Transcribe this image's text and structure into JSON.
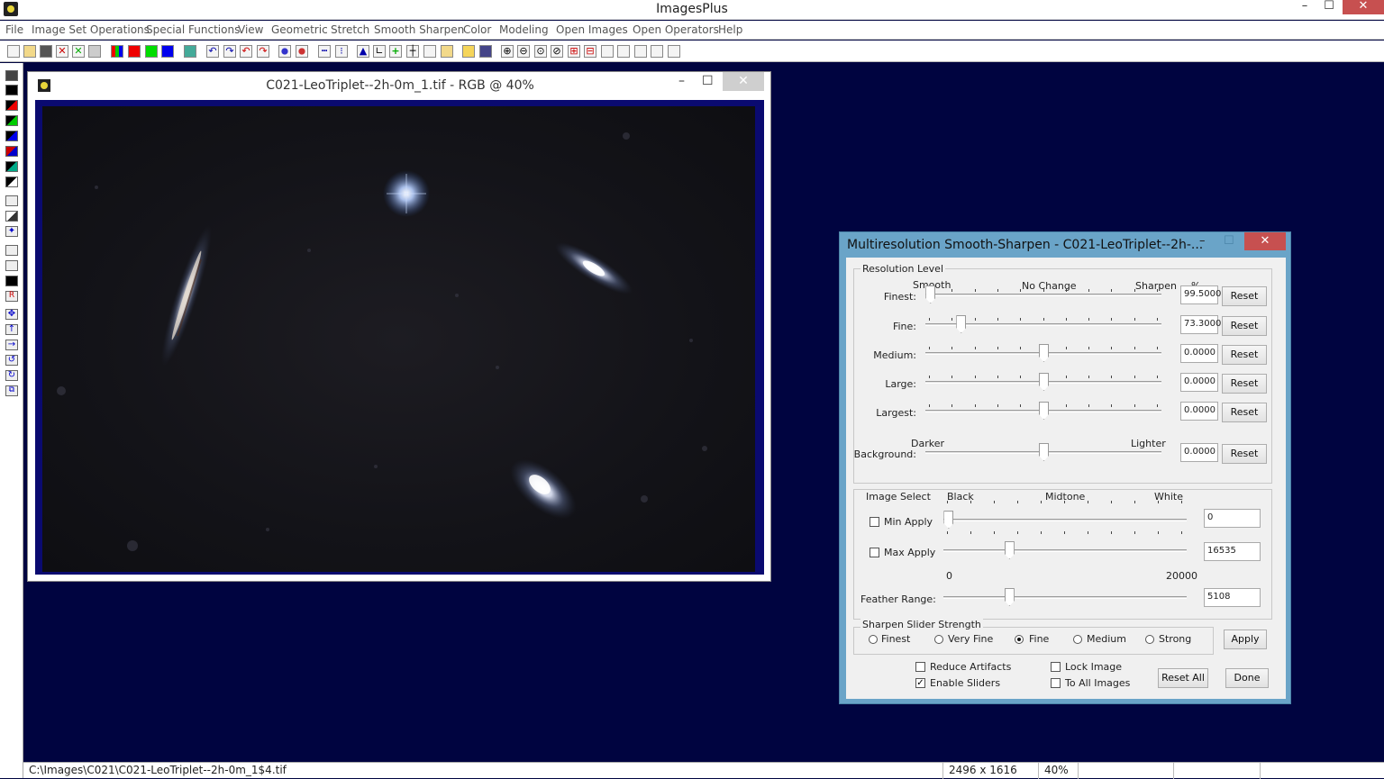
{
  "app": {
    "title": "ImagesPlus"
  },
  "menu": [
    "File",
    "Image Set Operations",
    "Special Functions",
    "View",
    "Geometric",
    "Stretch",
    "Smooth Sharpen",
    "Color",
    "Modeling",
    "Open Images",
    "Open Operators",
    "Help"
  ],
  "image_window": {
    "title": "C021-LeoTriplet--2h-0m_1.tif - RGB @ 40%"
  },
  "status": {
    "path": "C:\\Images\\C021\\C021-LeoTriplet--2h-0m_1$4.tif",
    "dimensions": "2496 x 1616",
    "zoom": "40%"
  },
  "dialog": {
    "title": "Multiresolution Smooth-Sharpen - C021-LeoTriplet--2h-...",
    "resolution_group": "Resolution Level",
    "col_smooth": "Smooth",
    "col_nochange": "No Change",
    "col_sharpen": "Sharpen",
    "col_pct": "%",
    "darker": "Darker",
    "lighter": "Lighter",
    "reset": "Reset",
    "rows": [
      {
        "label": "Finest:",
        "value": "99.5000",
        "level": 0.02
      },
      {
        "label": "Fine:",
        "value": "73.3000",
        "level": 0.15
      },
      {
        "label": "Medium:",
        "value": "0.0000",
        "level": 0.5
      },
      {
        "label": "Large:",
        "value": "0.0000",
        "level": 0.5
      },
      {
        "label": "Largest:",
        "value": "0.0000",
        "level": 0.5
      },
      {
        "label": "Background:",
        "value": "0.0000",
        "level": 0.5
      }
    ],
    "image_select": {
      "title": "Image Select",
      "black": "Black",
      "midtone": "Midtone",
      "white": "White",
      "min_label": "Min Apply",
      "min_value": "0",
      "min_level": 0.02,
      "max_label": "Max Apply",
      "max_value": "16535",
      "max_level": 0.27,
      "range_min": "0",
      "range_max": "20000",
      "feather_label": "Feather Range:",
      "feather_value": "5108",
      "feather_level": 0.27
    },
    "strength": {
      "title": "Sharpen Slider Strength",
      "options": [
        "Finest",
        "Very Fine",
        "Fine",
        "Medium",
        "Strong"
      ],
      "selected": "Fine",
      "apply": "Apply"
    },
    "options": {
      "reduce": "Reduce Artifacts",
      "lock": "Lock Image",
      "enable": "Enable Sliders",
      "toall": "To All Images",
      "enable_checked": true
    },
    "reset_all": "Reset All",
    "done": "Done"
  }
}
